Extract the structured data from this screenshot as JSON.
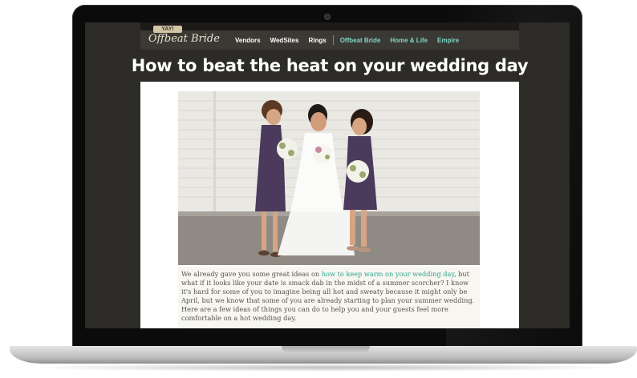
{
  "site": {
    "logo_badge": "YAY!",
    "logo_text": "Offbeat Bride",
    "nav": [
      {
        "label": "Vendors"
      },
      {
        "label": "WedSites"
      },
      {
        "label": "Rings"
      },
      {
        "label": "Offbeat Bride"
      },
      {
        "label": "Home & Life"
      },
      {
        "label": "Empire"
      }
    ],
    "colors": {
      "nav_bg": "#3b3934",
      "page_bg": "#2d2b27",
      "accent_teal": "#7fd6c4",
      "link": "#2fa58f"
    }
  },
  "article": {
    "title": "How to beat the heat on your wedding day",
    "photo_alt": "bride-and-bridesmaids-photo",
    "body_before_link": "We already gave you some great ideas on ",
    "link_text": "how to keep warm on your wedding day",
    "body_after_link": ", but what if it looks like your date is smack dab in the midst of a summer scorcher? I know it's hard for some of you to imagine being all hot and sweaty because it might only be April, but we know that some of you are already starting to plan your summer wedding. Here are a few ideas of things you can do to help you and your guests feel more comfortable on a hot wedding day."
  }
}
